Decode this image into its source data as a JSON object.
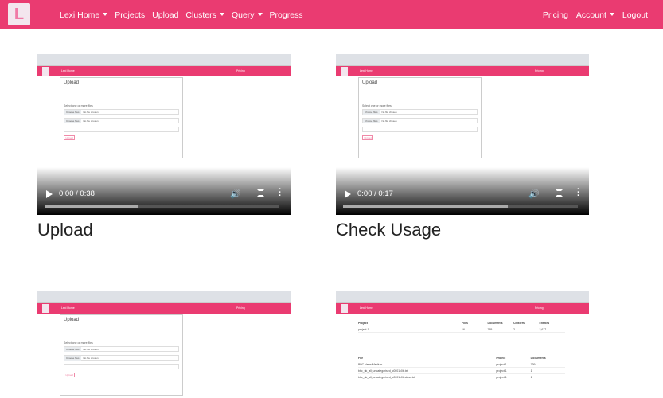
{
  "nav": {
    "logo": "L",
    "left": [
      "Lexi Home",
      "Projects",
      "Upload",
      "Clusters",
      "Query",
      "Progress"
    ],
    "right": [
      "Pricing",
      "Account",
      "Logout"
    ]
  },
  "videos": [
    {
      "title": "Upload",
      "time": "0:00 / 0:38",
      "progress": 0.4
    },
    {
      "title": "Check Usage",
      "time": "0:00 / 0:17",
      "progress": 0.7
    },
    {
      "title": "",
      "time": "",
      "progress": 0
    },
    {
      "title": "",
      "time": "",
      "progress": 0
    }
  ],
  "thumb": {
    "upload_heading": "Upload",
    "select_label": "Select one or more files",
    "choose": "Choose files",
    "no_file": "No file chosen",
    "upload_btn": "Upload",
    "table_headers": [
      "Project",
      "Files",
      "Documents",
      "Clusters",
      "Entities"
    ],
    "project_row": [
      "project 1",
      "16",
      "755",
      "2",
      "2,677"
    ],
    "file_headers": [
      "File",
      "Project",
      "Documents"
    ],
    "file_rows": [
      [
        "BBC News Medium",
        "project 1",
        "739"
      ],
      [
        "bbc_uk_all_uncategorised_c0001c0b.txt",
        "project 1",
        "1"
      ],
      [
        "bbc_uk_all_uncategorised_c0001c0b.class.txt",
        "project 1",
        "1"
      ]
    ]
  },
  "colors": {
    "brand": "#ea3b71"
  }
}
